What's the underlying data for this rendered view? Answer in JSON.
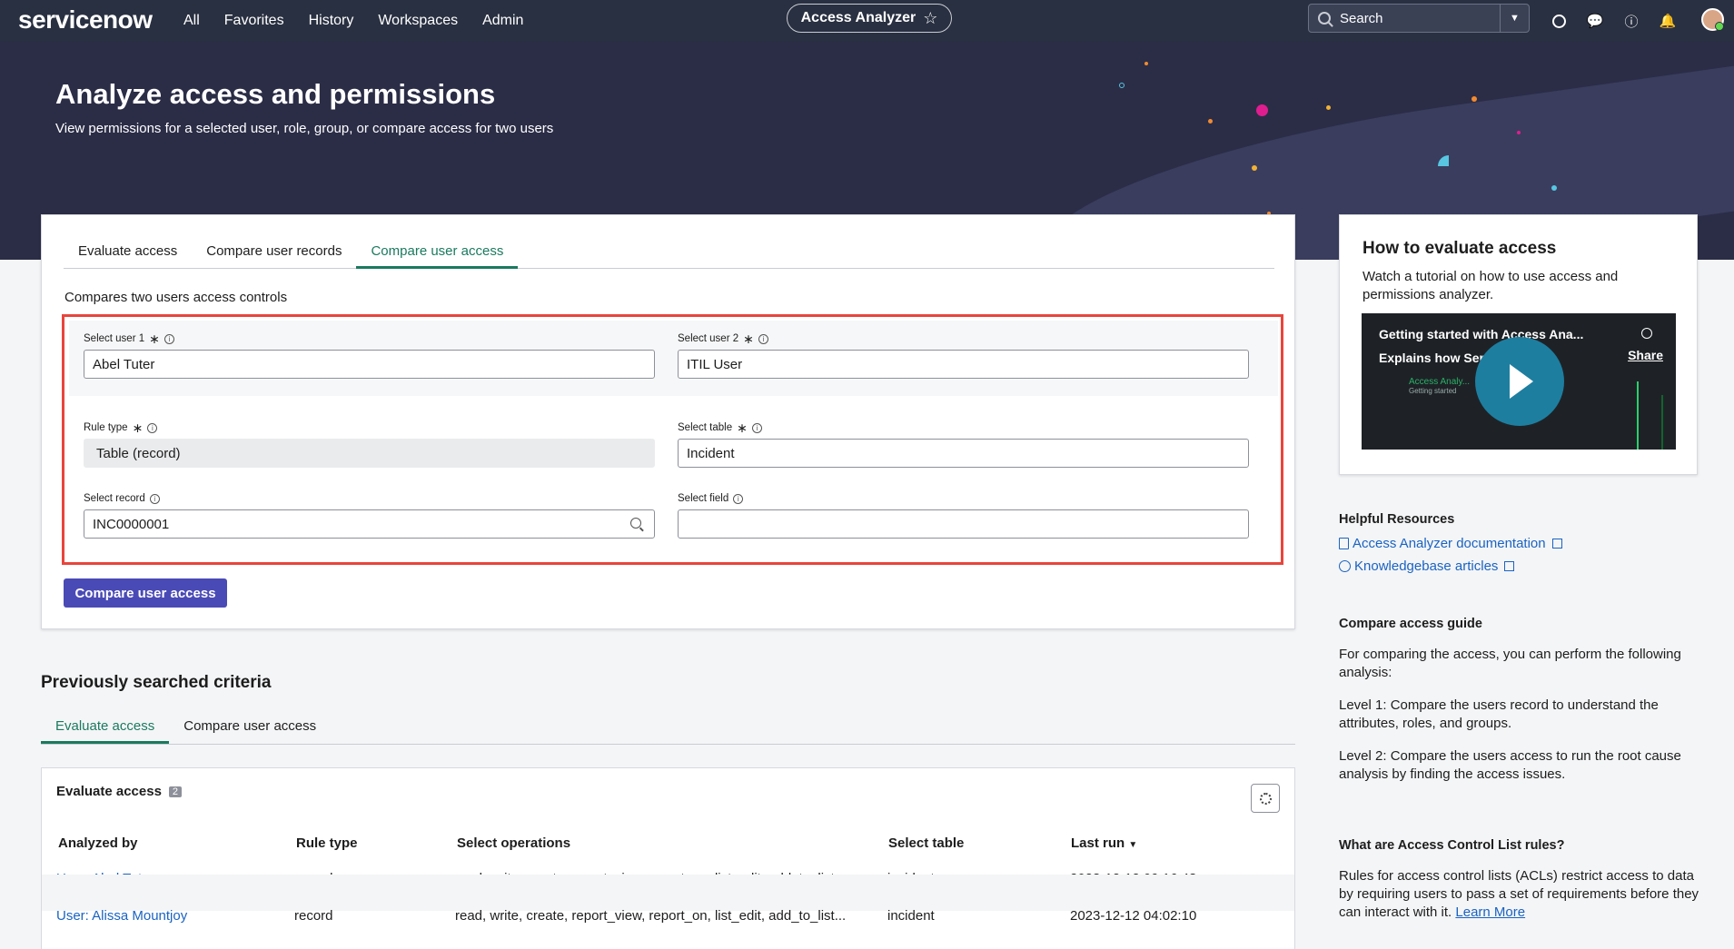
{
  "nav": {
    "logo": "servicenow",
    "links": [
      "All",
      "Favorites",
      "History",
      "Workspaces",
      "Admin"
    ],
    "app_name": "Access Analyzer",
    "search_placeholder": "Search"
  },
  "hero": {
    "title": "Analyze access and permissions",
    "subtitle": "View permissions for a selected user, role, group, or compare access for two users"
  },
  "main": {
    "tabs": [
      "Evaluate access",
      "Compare user records",
      "Compare user access"
    ],
    "active_tab": "Compare user access",
    "description": "Compares two users access controls",
    "fields": {
      "user1_label": "Select user 1",
      "user1_value": "Abel Tuter",
      "user2_label": "Select user 2",
      "user2_value": "ITIL User",
      "rule_type_label": "Rule type",
      "rule_type_value": "Table (record)",
      "table_label": "Select table",
      "table_value": "Incident",
      "record_label": "Select record",
      "record_value": "INC0000001",
      "field_label": "Select field",
      "field_value": ""
    },
    "button_label": "Compare user access"
  },
  "right": {
    "card_title": "How to evaluate access",
    "card_text": "Watch a tutorial on how to use access and permissions analyzer.",
    "video": {
      "title_line1": "Getting started with Access Ana...",
      "title_line2": "Explains how Ser...ss ...",
      "caption1": "Access Analy...",
      "caption2": "Getting started",
      "share": "Share"
    },
    "resources_title": "Helpful Resources",
    "resource_links": [
      "Access Analyzer documentation",
      "Knowledgebase articles"
    ],
    "guide_title": "Compare access guide",
    "guide_p1": "For comparing the access, you can perform the following analysis:",
    "guide_p2": "Level 1: Compare the users record to understand the attributes, roles, and groups.",
    "guide_p3": "Level 2: Compare the users access to run the root cause analysis by finding the access issues.",
    "acl_title": "What are Access Control List rules?",
    "acl_text": "Rules for access control lists (ACLs) restrict access to data by requiring users to pass a set of requirements before they can interact with it.",
    "acl_link": "Learn More"
  },
  "previous": {
    "title": "Previously searched criteria",
    "tabs": [
      "Evaluate access",
      "Compare user access"
    ],
    "active_tab": "Evaluate access",
    "table_title": "Evaluate access",
    "count": "2",
    "columns": [
      "Analyzed by",
      "Rule type",
      "Select operations",
      "Select table",
      "Last run"
    ],
    "rows": [
      {
        "analyzed_by": "User: Abel Tuter",
        "rule_type": "record",
        "operations": "read, write, create, report_view, report_on, list_edit, add_to_list...",
        "table": "incident",
        "last_run": "2023-12-12 09:16:48"
      },
      {
        "analyzed_by": "User: Alissa Mountjoy",
        "rule_type": "record",
        "operations": "read, write, create, report_view, report_on, list_edit, add_to_list...",
        "table": "incident",
        "last_run": "2023-12-12 04:02:10"
      }
    ]
  },
  "colors": {
    "nav_bg": "#293041",
    "hero_bg": "#2b2d47",
    "accent": "#1a7a5e",
    "button": "#4a4ab6",
    "highlight": "#e8453c",
    "link": "#1a63c2"
  }
}
